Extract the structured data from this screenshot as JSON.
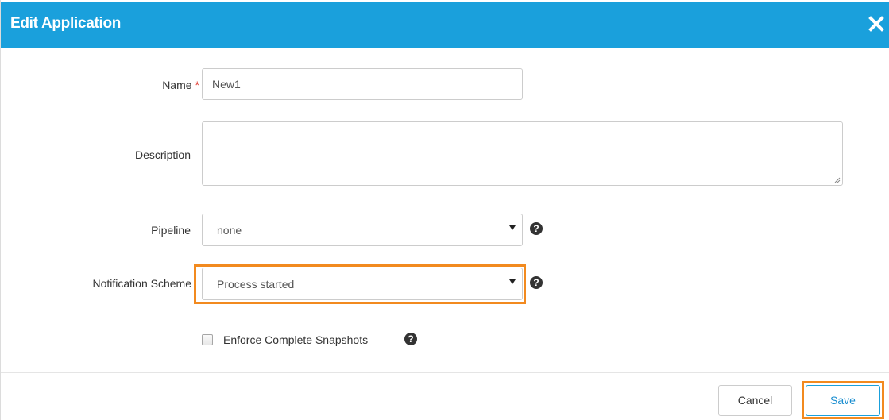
{
  "dialog": {
    "title": "Edit Application",
    "close_icon": "close-icon"
  },
  "form": {
    "name": {
      "label": "Name",
      "required_marker": "*",
      "value": "New1"
    },
    "description": {
      "label": "Description",
      "value": ""
    },
    "pipeline": {
      "label": "Pipeline",
      "selected": "none",
      "help_icon": "question-circle-icon"
    },
    "notification_scheme": {
      "label": "Notification Scheme",
      "selected": "Process started",
      "help_icon": "question-circle-icon"
    },
    "enforce_complete_snapshots": {
      "label": "Enforce Complete Snapshots",
      "checked": false,
      "help_icon": "question-circle-icon"
    }
  },
  "footer": {
    "cancel_label": "Cancel",
    "save_label": "Save"
  },
  "colors": {
    "header_bg": "#1aa0dc",
    "highlight": "#f28a1f",
    "required": "#e0352b",
    "save_text": "#1a8ed0"
  }
}
